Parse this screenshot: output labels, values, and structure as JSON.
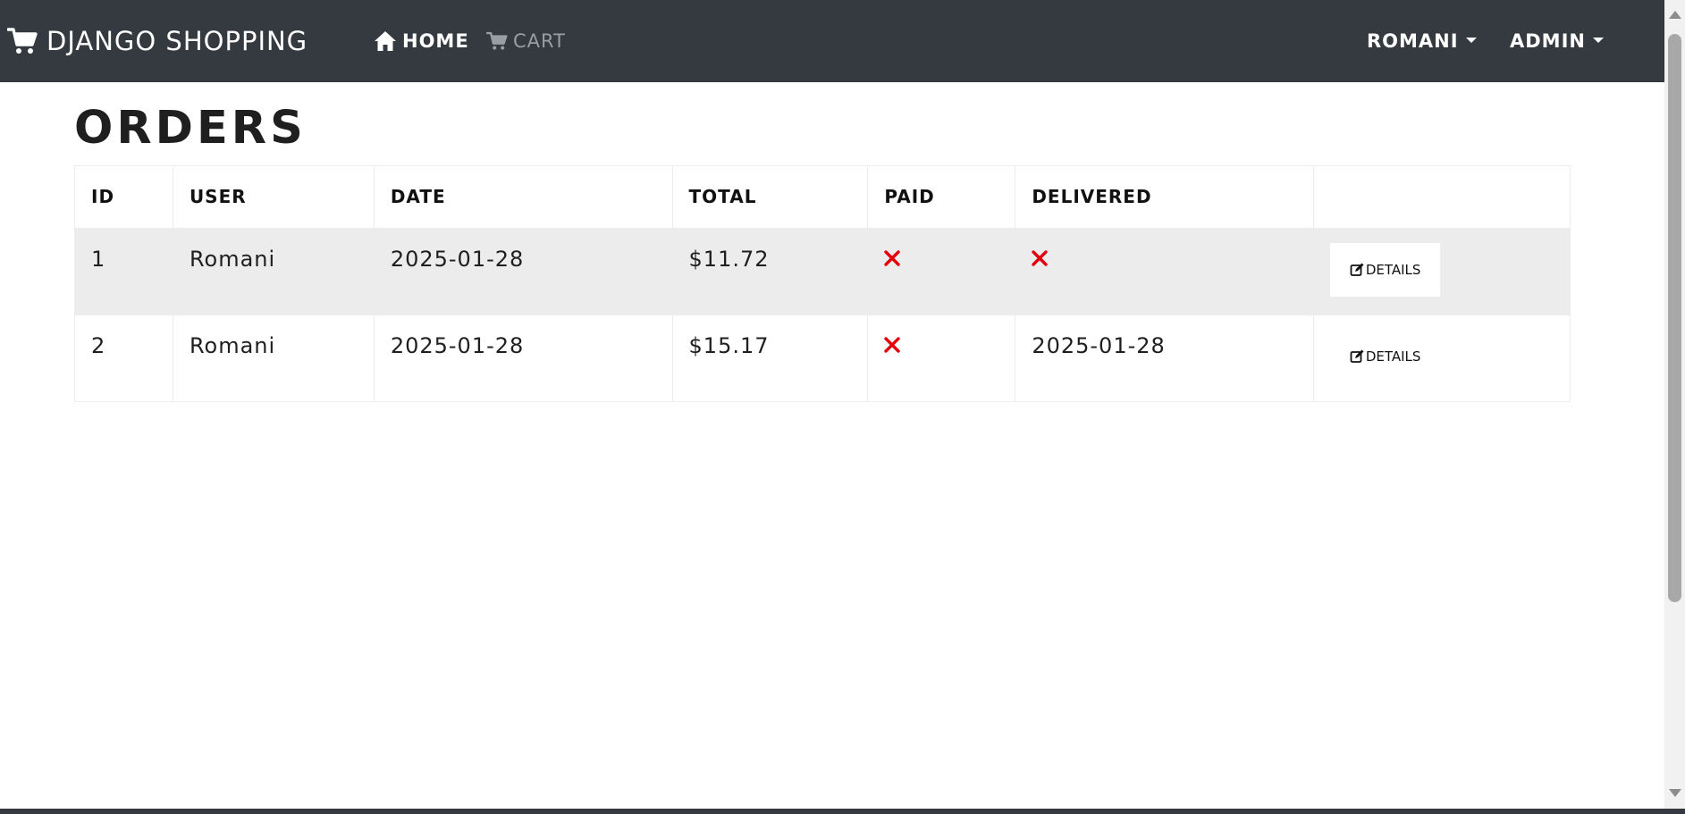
{
  "navbar": {
    "brand": "DJANGO SHOPPING",
    "brand_icon": "cart-icon",
    "links": {
      "home": "HOME",
      "cart": "CART"
    },
    "user_menu": "ROMANI",
    "admin_menu": "ADMIN"
  },
  "page": {
    "title": "ORDERS"
  },
  "table": {
    "headers": [
      "ID",
      "USER",
      "DATE",
      "TOTAL",
      "PAID",
      "DELIVERED",
      ""
    ],
    "rows": [
      {
        "id": "1",
        "user": "Romani",
        "date": "2025-01-28",
        "total": "$11.72",
        "paid": false,
        "delivered": false,
        "delivered_date": "",
        "action": "DETAILS"
      },
      {
        "id": "2",
        "user": "Romani",
        "date": "2025-01-28",
        "total": "$15.17",
        "paid": false,
        "delivered": true,
        "delivered_date": "2025-01-28",
        "action": "DETAILS"
      }
    ]
  },
  "colors": {
    "navbar_bg": "#343a40",
    "stripe_bg": "#ececec",
    "not_ok": "#e3000b"
  }
}
